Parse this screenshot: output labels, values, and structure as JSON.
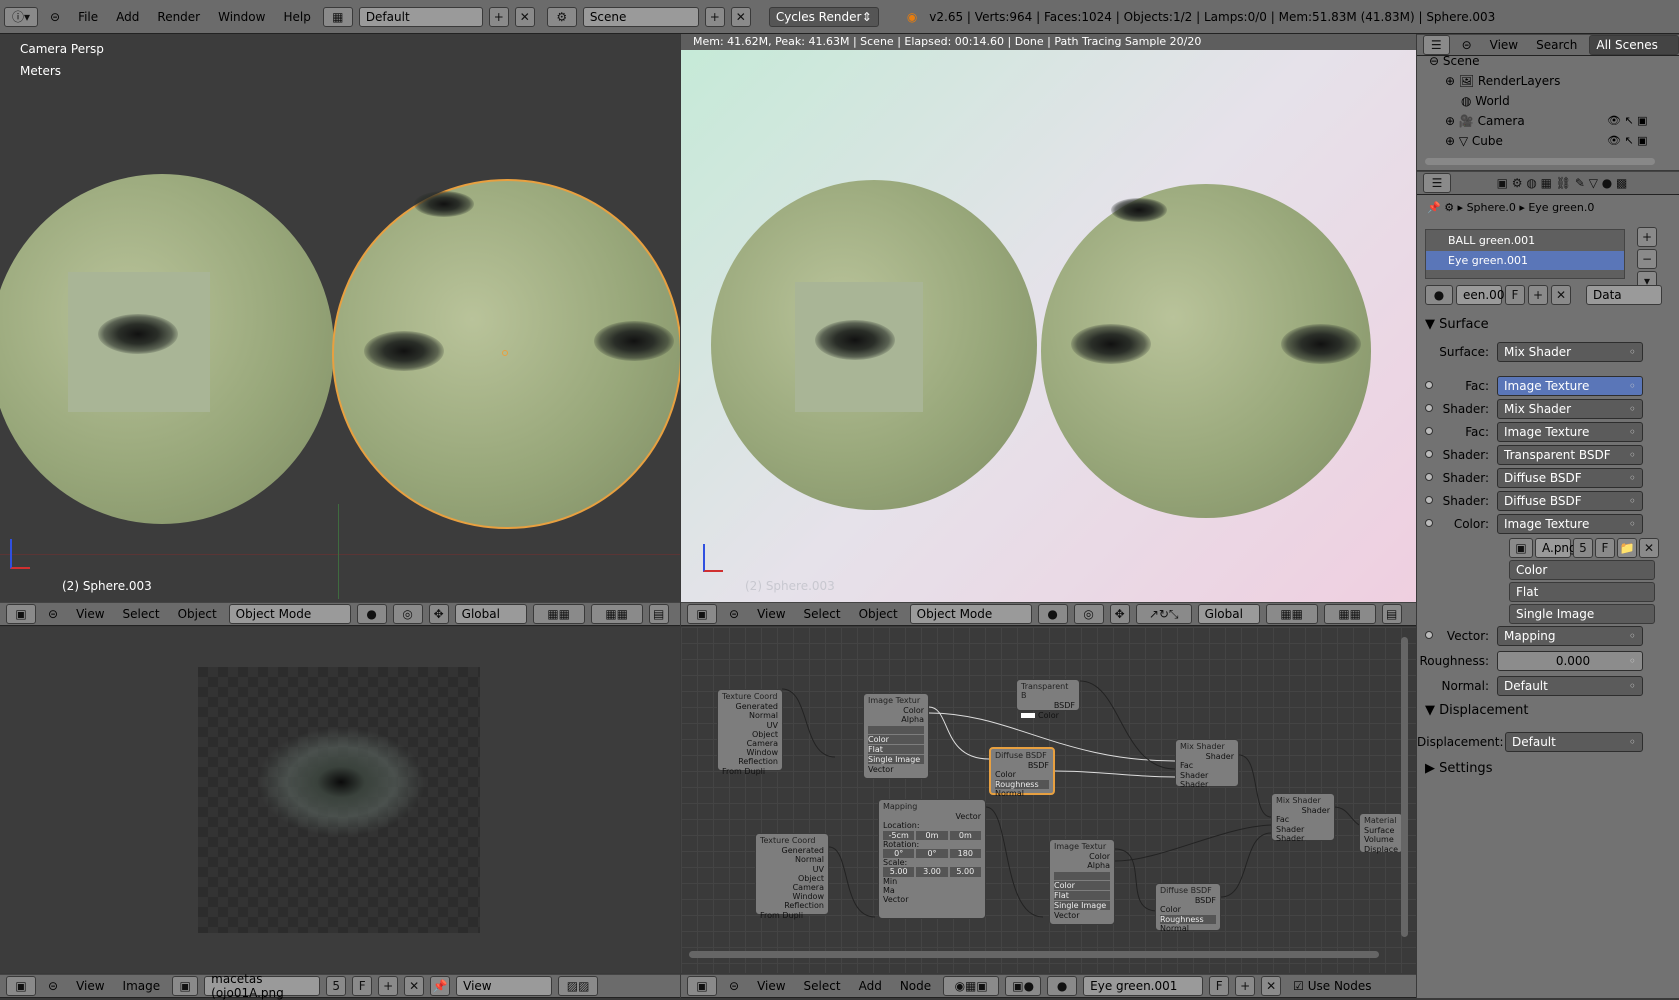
{
  "topbar": {
    "menus": [
      "File",
      "Add",
      "Render",
      "Window",
      "Help"
    ],
    "screen_layout": "Default",
    "scene": "Scene",
    "render_engine": "Cycles Render",
    "stats": "v2.65 | Verts:964 | Faces:1024 | Objects:1/2 | Lamps:0/0 | Mem:51.83M (41.83M) | Sphere.003"
  },
  "viewport_left": {
    "view_name": "Camera Persp",
    "units": "Meters",
    "object_label": "(2) Sphere.003",
    "header": {
      "menus": [
        "View",
        "Select",
        "Object"
      ],
      "mode": "Object Mode",
      "orientation": "Global"
    }
  },
  "viewport_render": {
    "status": "Mem: 41.62M, Peak: 41.63M | Scene | Elapsed: 00:14.60 | Done | Path Tracing Sample 20/20",
    "object_label": "(2) Sphere.003",
    "header": {
      "menus": [
        "View",
        "Select",
        "Object"
      ],
      "mode": "Object Mode",
      "orientation": "Global"
    }
  },
  "image_editor": {
    "header": {
      "menus": [
        "View",
        "Image"
      ],
      "image_name": "macetas (ojo01A.png",
      "users": "5",
      "fake": "F",
      "display": "View"
    }
  },
  "node_editor": {
    "header": {
      "menus": [
        "View",
        "Select",
        "Add",
        "Node"
      ],
      "material": "Eye green.001",
      "fake": "F",
      "use_nodes": "Use Nodes"
    },
    "nodes": {
      "texcoord1": {
        "title": "Texture Coord",
        "outputs": [
          "Generated",
          "Normal",
          "UV",
          "Object",
          "Camera",
          "Window",
          "Reflection"
        ],
        "option": "From Dupli"
      },
      "imgtex1": {
        "title": "Image Textur",
        "outputs": [
          "Color",
          "Alpha"
        ],
        "opts": [
          "Color",
          "Flat",
          "Single Image"
        ],
        "input": "Vector"
      },
      "transparent": {
        "title": "Transparent B",
        "out": "BSDF",
        "in": "Color"
      },
      "diffuse1": {
        "title": "Diffuse BSDF",
        "out": "BSDF",
        "ins": [
          "Color",
          "Roughness",
          "Normal"
        ]
      },
      "mix1": {
        "title": "Mix Shader",
        "out": "Shader",
        "ins": [
          "Fac",
          "Shader",
          "Shader"
        ]
      },
      "mapping": {
        "title": "Mapping",
        "out": "Vector",
        "labels": [
          "Location:",
          "Rotation:",
          "Scale:",
          "Min",
          "Ma"
        ],
        "loc": [
          "-5cm",
          "0m",
          "0m"
        ],
        "rot": [
          "0°",
          "0°",
          "180"
        ],
        "scale": [
          "5.00",
          "3.00",
          "5.00"
        ],
        "in": "Vector"
      },
      "texcoord2": {
        "title": "Texture Coord",
        "outputs": [
          "Generated",
          "Normal",
          "UV",
          "Object",
          "Camera",
          "Window",
          "Reflection"
        ],
        "option": "From Dupli"
      },
      "imgtex2": {
        "title": "Image Textur",
        "outputs": [
          "Color",
          "Alpha"
        ],
        "opts": [
          "Color",
          "Flat",
          "Single Image"
        ],
        "input": "Vector"
      },
      "diffuse2": {
        "title": "Diffuse BSDF",
        "out": "BSDF",
        "ins": [
          "Color",
          "Roughness",
          "Normal"
        ]
      },
      "mix2": {
        "title": "Mix Shader",
        "out": "Shader",
        "ins": [
          "Fac",
          "Shader",
          "Shader"
        ]
      },
      "output": {
        "title": "Material",
        "ins": [
          "Surface",
          "Volume",
          "Displace"
        ]
      }
    }
  },
  "outliner": {
    "header": {
      "view": "View",
      "search": "Search",
      "filter": "All Scenes"
    },
    "items": [
      "Scene",
      "RenderLayers",
      "World",
      "Camera",
      "Cube"
    ]
  },
  "properties": {
    "breadcrumb": [
      "Sphere.0",
      "Eye green.0"
    ],
    "materials": [
      "BALL green.001",
      "Eye green.001"
    ],
    "material_name": "een.001",
    "fake": "F",
    "link": "Data",
    "surface_section": "Surface",
    "rows": [
      {
        "label": "Surface:",
        "value": "Mix Shader"
      },
      {
        "label": "Fac:",
        "value": "Image Texture"
      },
      {
        "label": "Shader:",
        "value": "Mix Shader"
      },
      {
        "label": "Fac:",
        "value": "Image Texture"
      },
      {
        "label": "Shader:",
        "value": "Transparent BSDF"
      },
      {
        "label": "Shader:",
        "value": "Diffuse BSDF"
      },
      {
        "label": "Shader:",
        "value": "Diffuse BSDF"
      },
      {
        "label": "Color:",
        "value": "Image Texture"
      }
    ],
    "image": {
      "name": "A.png",
      "users": "5",
      "fake": "F"
    },
    "image_opts": [
      "Color",
      "Flat",
      "Single Image"
    ],
    "vector": {
      "label": "Vector:",
      "value": "Mapping"
    },
    "roughness": {
      "label": "Roughness:",
      "value": "0.000"
    },
    "normal": {
      "label": "Normal:",
      "value": "Default"
    },
    "displacement_section": "Displacement",
    "displacement": {
      "label": "Displacement:",
      "value": "Default"
    },
    "settings_section": "Settings"
  }
}
